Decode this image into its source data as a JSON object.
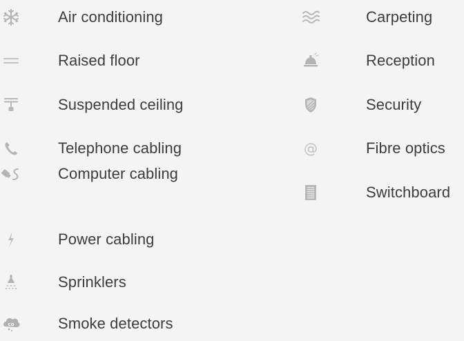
{
  "features": {
    "left": [
      {
        "icon": "snowflake-icon",
        "label": "Air conditioning"
      },
      {
        "icon": "raised-floor-icon",
        "label": "Raised floor"
      },
      {
        "icon": "ceiling-lamp-icon",
        "label": "Suspended ceiling"
      },
      {
        "icon": "telephone-icon",
        "label": "Telephone cabling"
      },
      {
        "icon": "computer-cable-icon",
        "label": "Computer cabling"
      },
      {
        "icon": "lightning-icon",
        "label": "Power cabling"
      },
      {
        "icon": "sprinkler-icon",
        "label": "Sprinklers"
      },
      {
        "icon": "co-detector-icon",
        "label": "Smoke detectors"
      }
    ],
    "right": [
      {
        "icon": "carpet-waves-icon",
        "label": "Carpeting"
      },
      {
        "icon": "reception-bell-icon",
        "label": "Reception"
      },
      {
        "icon": "shield-icon",
        "label": "Security"
      },
      {
        "icon": "at-sign-icon",
        "label": "Fibre optics"
      },
      {
        "icon": "switchboard-icon",
        "label": "Switchboard"
      }
    ]
  },
  "colors": {
    "background": "#f4f4f4",
    "text": "#3c3c3c",
    "icon": "#b4b4b4"
  }
}
